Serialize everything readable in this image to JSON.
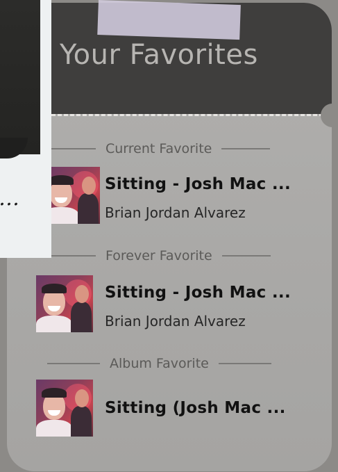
{
  "header": {
    "title": "Your Favorites"
  },
  "overlay": {
    "note_text": "…"
  },
  "sections": [
    {
      "label": "Current Favorite",
      "song": {
        "title": "Sitting - Josh Mac ...",
        "artist": "Brian Jordan Alvarez"
      }
    },
    {
      "label": "Forever Favorite",
      "song": {
        "title": "Sitting - Josh Mac ...",
        "artist": "Brian Jordan Alvarez"
      }
    },
    {
      "label": "Album Favorite",
      "song": {
        "title": "Sitting (Josh Mac ...",
        "artist": ""
      }
    }
  ],
  "icons": {
    "album_art": "album-art-image"
  },
  "colors": {
    "card_header": "#3f3e3d",
    "card_body": "#adacaa",
    "tape": "#d4cde0"
  }
}
